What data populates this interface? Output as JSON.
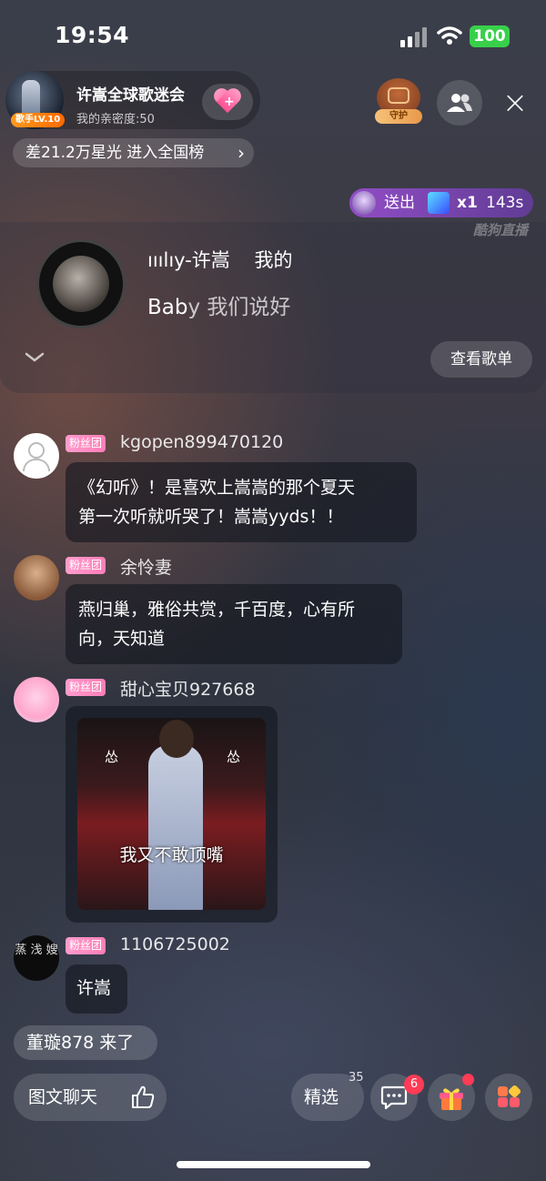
{
  "status_bar": {
    "time": "19:54",
    "battery": "100"
  },
  "header": {
    "group_title": "许嵩全球歌迷会",
    "intimacy": "我的亲密度:50",
    "level_badge": "歌手LV.10",
    "guard_label": "守护",
    "close_glyph": "×",
    "rank_text": "差21.2万星光 进入全国榜",
    "rank_chevron": "›"
  },
  "gift_notice": {
    "action": "送出",
    "count": "x1",
    "seconds": "143s",
    "watermark": "酷狗直播"
  },
  "music": {
    "song_prefix": "ııılıy-许嵩",
    "song_suffix": "我的",
    "lyric_lead": "Bab",
    "lyric_rest": "y 我们说好",
    "playlist_button": "查看歌单"
  },
  "messages": [
    {
      "badge": "粉丝团",
      "user": "kgopen899470120",
      "text_line1": "《幻听》！是喜欢上嵩嵩的那个夏天",
      "text_line2": "第一次听就听哭了！嵩嵩yyds！！"
    },
    {
      "badge": "粉丝团",
      "user": "余怜妻",
      "text_line1": "燕归巢，雅俗共赏，千百度，心有所",
      "text_line2": "向，天知道"
    },
    {
      "badge": "粉丝团",
      "user": "甜心宝贝927668",
      "image_caption_left": "怂",
      "image_caption_right": "怂",
      "image_caption_main": "我又不敢顶嘴"
    },
    {
      "badge": "粉丝团",
      "user": "1106725002",
      "text": "许嵩",
      "avatar_text": "蒸 浅 嫂"
    }
  ],
  "join_notice": "董璇878 来了",
  "bottom_bar": {
    "chat_button": "图文聊天",
    "featured_button": "精选",
    "featured_count": "35",
    "message_badge": "6"
  },
  "colors": {
    "accent_pink": "#ff7eb8",
    "badge_red": "#ff3b55",
    "battery_green": "#38d04a"
  }
}
